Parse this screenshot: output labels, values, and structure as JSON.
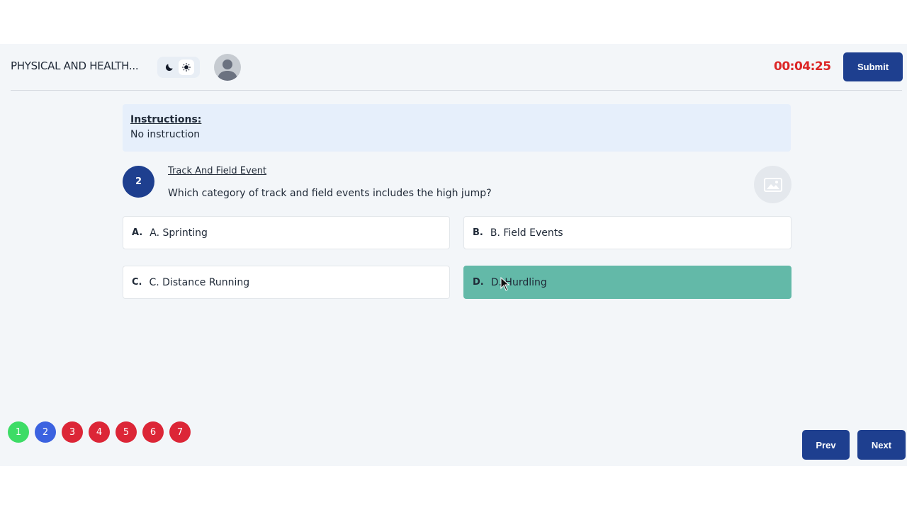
{
  "header": {
    "course_title": "PHYSICAL AND HEALTH...",
    "timer": "00:04:25",
    "submit_label": "Submit",
    "theme_icons": [
      "moon-icon",
      "sun-icon"
    ]
  },
  "instructions": {
    "heading": "Instructions:",
    "text": "No instruction"
  },
  "question": {
    "number": "2",
    "topic": "Track And Field Event",
    "text": "Which category of track and field events includes the high jump?",
    "options": [
      {
        "letter": "A.",
        "label": "A. Sprinting",
        "selected": false
      },
      {
        "letter": "B.",
        "label": "B. Field Events",
        "selected": false
      },
      {
        "letter": "C.",
        "label": "C. Distance Running",
        "selected": false
      },
      {
        "letter": "D.",
        "label": "D. Hurdling",
        "selected": true
      }
    ]
  },
  "navigation": {
    "questions": [
      {
        "label": "1",
        "status": "answered",
        "color": "#3ddc66"
      },
      {
        "label": "2",
        "status": "current",
        "color": "#3b62e0"
      },
      {
        "label": "3",
        "status": "unanswered",
        "color": "#dc2637"
      },
      {
        "label": "4",
        "status": "unanswered",
        "color": "#dc2637"
      },
      {
        "label": "5",
        "status": "unanswered",
        "color": "#dc2637"
      },
      {
        "label": "6",
        "status": "unanswered",
        "color": "#dc2637"
      },
      {
        "label": "7",
        "status": "unanswered",
        "color": "#dc2637"
      }
    ],
    "prev_label": "Prev",
    "next_label": "Next"
  },
  "colors": {
    "primary": "#1e3f8f",
    "timer": "#dc2626",
    "selected_option": "#63b9a8",
    "instructions_bg": "#e6effb"
  }
}
